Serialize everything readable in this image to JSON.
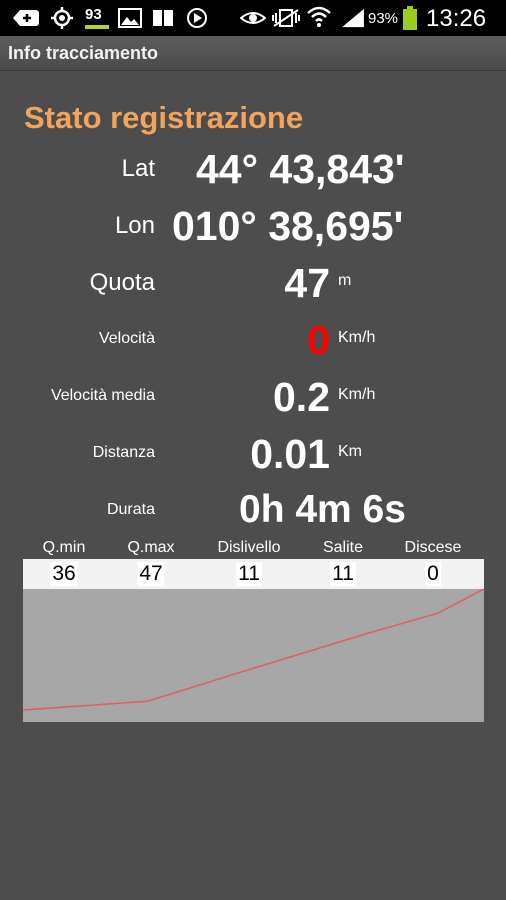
{
  "status_bar": {
    "notification_icons": [
      "add-icon",
      "gps-icon",
      "badge-icon",
      "image-icon",
      "book-icon",
      "play-icon"
    ],
    "badge_number": "93",
    "system_icons": [
      "eye-icon",
      "vibrate-icon",
      "wifi-icon",
      "signal-icon",
      "battery-icon"
    ],
    "battery_percent": "93%",
    "time": "13:26"
  },
  "action_bar": {
    "title": "Info tracciamento"
  },
  "section_title": "Stato registrazione",
  "rows": {
    "lat": {
      "label": "Lat",
      "value": "44° 43,843'"
    },
    "lon": {
      "label": "Lon",
      "value": "010° 38,695'"
    },
    "quota": {
      "label": "Quota",
      "value": "47",
      "unit": "m"
    },
    "velocita": {
      "label": "Velocità",
      "value": "0",
      "unit": "Km/h"
    },
    "velocita_media": {
      "label": "Velocità media",
      "value": "0.2",
      "unit": "Km/h"
    },
    "distanza": {
      "label": "Distanza",
      "value": "0.01",
      "unit": "Km"
    },
    "durata": {
      "label": "Durata",
      "value": "0h 4m 6s"
    }
  },
  "stats": {
    "headers": [
      "Q.min",
      "Q.max",
      "Dislivello",
      "Salite",
      "Discese"
    ],
    "values": [
      "36",
      "47",
      "11",
      "11",
      "0"
    ]
  },
  "colors": {
    "accent": "#f3a45a",
    "speed_value": "#ff0000",
    "chart_line": "#e06060",
    "chart_bg": "#a6a6a6",
    "background": "#4d4d4d"
  },
  "chart_data": {
    "type": "line",
    "title": "",
    "xlabel": "",
    "ylabel": "",
    "ylim": [
      36,
      47
    ],
    "series": [
      {
        "x": [
          0,
          0.27,
          0.5,
          0.75,
          0.9,
          1.0
        ],
        "values": [
          36,
          36.8,
          39.8,
          43,
          44.8,
          47
        ]
      }
    ]
  }
}
